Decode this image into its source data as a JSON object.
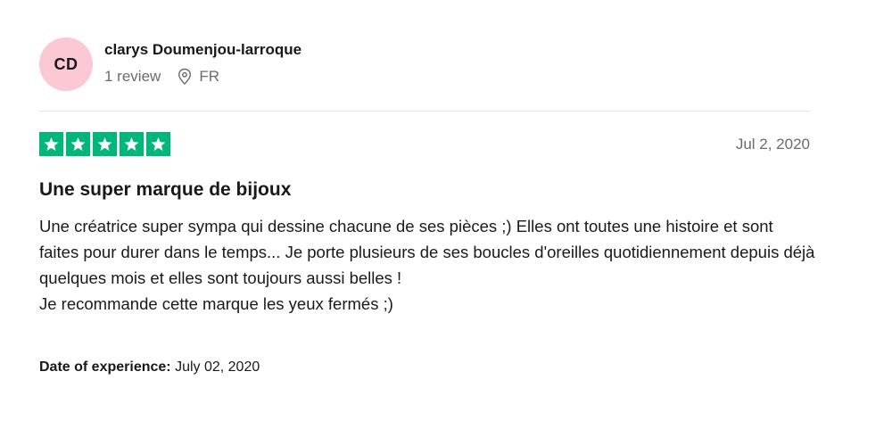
{
  "consumer": {
    "initials": "CD",
    "avatar_color": "#fbc8d4",
    "name": "clarys Doumenjou-larroque",
    "review_count": "1 review",
    "location_icon": "location-pin-icon",
    "country": "FR"
  },
  "review": {
    "rating": 5,
    "rating_max": 5,
    "star_color": "#00b67a",
    "date": "Jul 2, 2020",
    "title": "Une super marque de bijoux",
    "body_paragraphs": [
      "Une créatrice super sympa qui dessine chacune de ses pièces ;) Elles ont toutes une histoire et sont faites pour durer dans le temps... Je porte plusieurs de ses boucles d'oreilles quotidiennement depuis déjà quelques mois et elles sont toujours aussi belles !",
      "Je recommande cette marque les yeux fermés ;)"
    ],
    "experience_label": "Date of experience:",
    "experience_date": "July 02, 2020"
  }
}
